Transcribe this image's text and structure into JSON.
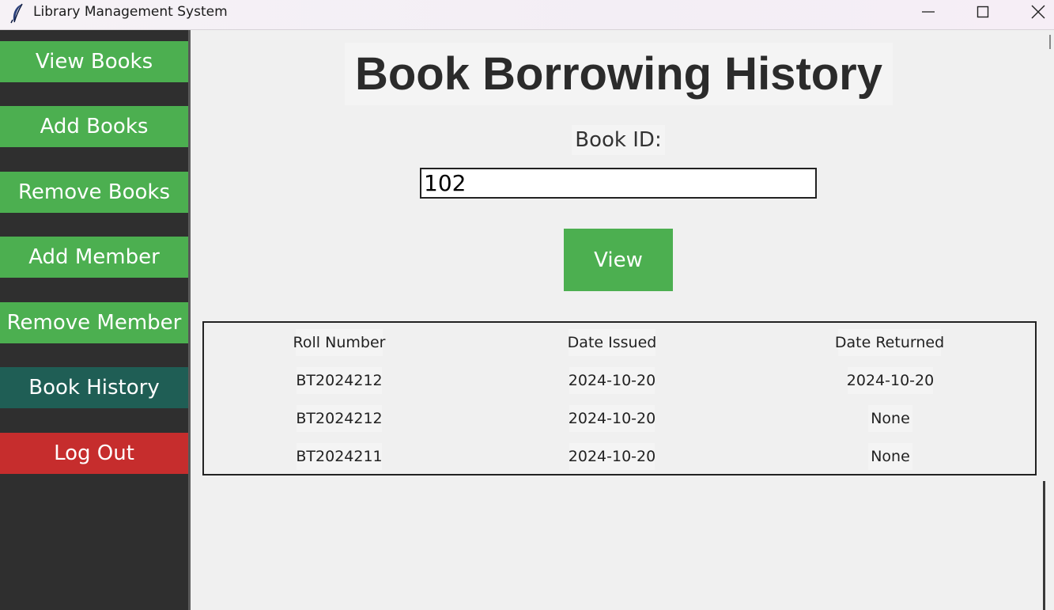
{
  "window": {
    "title": "Library Management System"
  },
  "sidebar": {
    "items": [
      {
        "label": "View Books"
      },
      {
        "label": "Add Books"
      },
      {
        "label": "Remove Books"
      },
      {
        "label": "Add Member"
      },
      {
        "label": "Remove Member"
      },
      {
        "label": "Book History"
      },
      {
        "label": "Log Out"
      }
    ],
    "active": "Book History"
  },
  "main": {
    "title": "Book Borrowing History",
    "book_id_label": "Book ID:",
    "book_id_value": "102",
    "view_button": "View",
    "table": {
      "headers": [
        "Roll Number",
        "Date Issued",
        "Date Returned"
      ],
      "rows": [
        [
          "BT2024212",
          "2024-10-20",
          "2024-10-20"
        ],
        [
          "BT2024212",
          "2024-10-20",
          "None"
        ],
        [
          "BT2024211",
          "2024-10-20",
          "None"
        ]
      ]
    }
  },
  "colors": {
    "sidebar_bg": "#2f2f2f",
    "button_green": "#4caf50",
    "active_teal": "#1f5e55",
    "logout_red": "#c62d2d"
  }
}
